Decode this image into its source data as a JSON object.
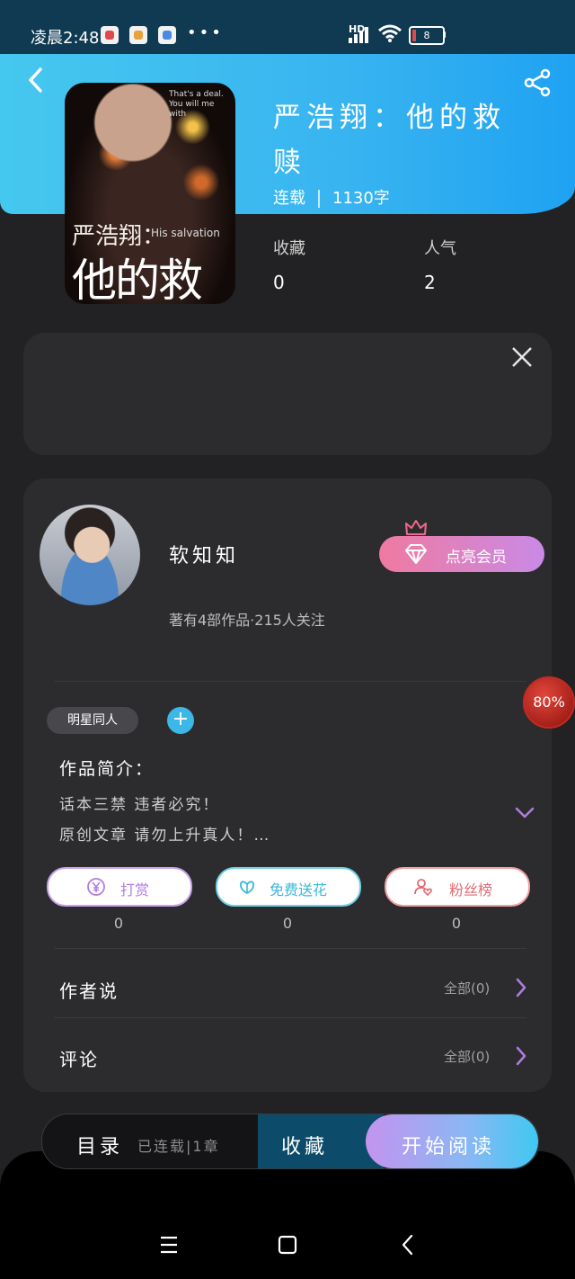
{
  "status_bar": {
    "time": "凌晨2:48",
    "dots": "•••",
    "network": "HD",
    "battery": "8"
  },
  "book": {
    "title": "严浩翔：他的救赎",
    "cover_subtitle": "严浩翔：",
    "cover_main": "他的救赎",
    "cover_en": "His salvation",
    "cover_quote": "That's a deal. You will me with",
    "status": "连载",
    "word_count": "1130字",
    "favorites_label": "收藏",
    "favorites": "0",
    "popularity_label": "人气",
    "popularity": "2"
  },
  "author": {
    "name": "软知知",
    "works_info": "著有4部作品·215人关注",
    "vip_label": "点亮会员"
  },
  "progress_badge": "80%",
  "tag": {
    "label": "明星同人",
    "add": "+"
  },
  "intro": {
    "heading": "作品简介：",
    "lines": [
      "话本三禁  违者必究！",
      "原创文章  请勿上升真人！…"
    ]
  },
  "actions": [
    {
      "label": "打赏",
      "count": "0"
    },
    {
      "label": "免费送花",
      "count": "0"
    },
    {
      "label": "粉丝榜",
      "count": "0"
    }
  ],
  "rows": [
    {
      "label": "作者说",
      "right": "全部(0)"
    },
    {
      "label": "评论",
      "right": "全部(0)"
    }
  ],
  "dock": {
    "catalog": "目录",
    "catalog_status": "已连载|1章",
    "collect": "收藏",
    "read": "开始阅读"
  },
  "colors": {
    "header_blue": "#38b4f0",
    "vip_gradient_start": "#ef7aa0",
    "vip_gradient_end": "#c98ae6",
    "badge_red": "#c52a22",
    "accent_purple": "#b07de0"
  }
}
